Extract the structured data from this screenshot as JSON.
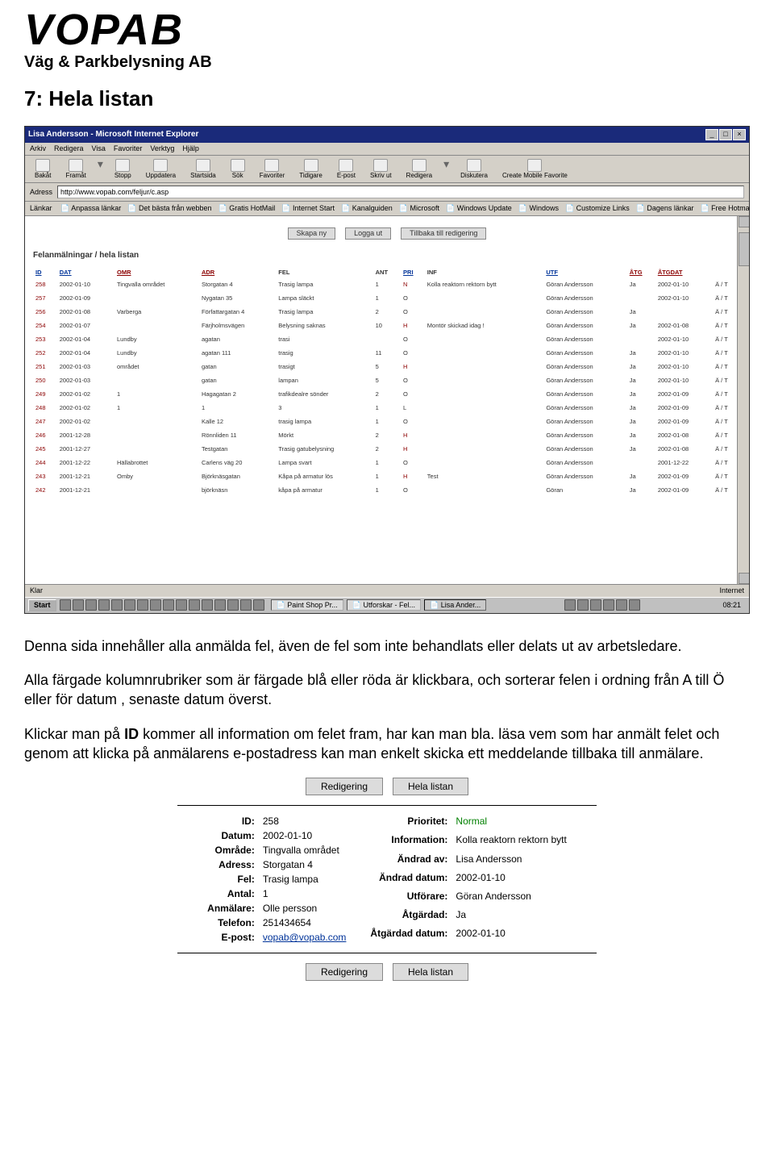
{
  "logo": {
    "word": "VOPAB",
    "sub": "Väg & Parkbelysning AB"
  },
  "section_title": "7: Hela listan",
  "browser": {
    "title": "Lisa Andersson - Microsoft Internet Explorer",
    "menu": [
      "Arkiv",
      "Redigera",
      "Visa",
      "Favoriter",
      "Verktyg",
      "Hjälp"
    ],
    "tools": [
      "Bakåt",
      "Framåt",
      "Stopp",
      "Uppdatera",
      "Startsida",
      "Sök",
      "Favoriter",
      "Tidigare",
      "E-post",
      "Skriv ut",
      "Redigera",
      "Diskutera",
      "Create Mobile Favorite"
    ],
    "address_label": "Adress",
    "address": "http://www.vopab.com/feljur/c.asp",
    "links_label": "Länkar",
    "links": [
      "Anpassa länkar",
      "Det bästa från webben",
      "Gratis HotMail",
      "Internet Start",
      "Kanalguiden",
      "Microsoft",
      "Windows Update",
      "Windows",
      "Customize Links",
      "Dagens länkar",
      "Free Hotmail"
    ],
    "page_buttons": [
      "Skapa ny",
      "Logga ut",
      "Tillbaka till redigering"
    ],
    "table_title": "Felanmälningar / hela listan",
    "headers": [
      {
        "t": "ID",
        "cls": "blue"
      },
      {
        "t": "DAT",
        "cls": "blue"
      },
      {
        "t": "OMR",
        "cls": "red"
      },
      {
        "t": "ADR",
        "cls": "red"
      },
      {
        "t": "FEL",
        "cls": ""
      },
      {
        "t": "ANT",
        "cls": ""
      },
      {
        "t": "PRI",
        "cls": "blue"
      },
      {
        "t": "INF",
        "cls": ""
      },
      {
        "t": "UTF",
        "cls": "blue"
      },
      {
        "t": "ÅTG",
        "cls": "red"
      },
      {
        "t": "ÅTGDAT",
        "cls": "red"
      },
      {
        "t": "",
        "cls": ""
      }
    ],
    "rows": [
      {
        "id": "258",
        "dat": "2002-01-10",
        "omr": "Tingvalla området",
        "adr": "Storgatan 4",
        "fel": "Trasig lampa",
        "ant": "1",
        "pri": "N",
        "inf": "Kolla reaktorn rektorn bytt",
        "utf": "Göran Andersson",
        "atg": "Ja",
        "atgdat": "2002-01-10",
        "act": "Ä / T"
      },
      {
        "id": "257",
        "dat": "2002-01-09",
        "omr": "",
        "adr": "Nygatan 35",
        "fel": "Lampa släckt",
        "ant": "1",
        "pri": "O",
        "inf": "",
        "utf": "Göran Andersson",
        "atg": "",
        "atgdat": "2002-01-10",
        "act": "Ä / T"
      },
      {
        "id": "256",
        "dat": "2002-01-08",
        "omr": "Varberga",
        "adr": "Författargatan 4",
        "fel": "Trasig lampa",
        "ant": "2",
        "pri": "O",
        "inf": "",
        "utf": "Göran Andersson",
        "atg": "Ja",
        "atgdat": "",
        "act": "Ä / T"
      },
      {
        "id": "254",
        "dat": "2002-01-07",
        "omr": "",
        "adr": "Färjholmsvägen",
        "fel": "Belysning saknas",
        "ant": "10",
        "pri": "H",
        "inf": "Montör skickad idag !",
        "utf": "Göran Andersson",
        "atg": "Ja",
        "atgdat": "2002-01-08",
        "act": "Ä / T"
      },
      {
        "id": "253",
        "dat": "2002-01-04",
        "omr": "Lundby",
        "adr": "agatan",
        "fel": "trasi",
        "ant": "",
        "pri": "O",
        "inf": "",
        "utf": "Göran Andersson",
        "atg": "",
        "atgdat": "2002-01-10",
        "act": "Ä / T"
      },
      {
        "id": "252",
        "dat": "2002-01-04",
        "omr": "Lundby",
        "adr": "agatan 111",
        "fel": "trasig",
        "ant": "11",
        "pri": "O",
        "inf": "",
        "utf": "Göran Andersson",
        "atg": "Ja",
        "atgdat": "2002-01-10",
        "act": "Ä / T"
      },
      {
        "id": "251",
        "dat": "2002-01-03",
        "omr": "området",
        "adr": "gatan",
        "fel": "trasigt",
        "ant": "5",
        "pri": "H",
        "inf": "",
        "utf": "Göran Andersson",
        "atg": "Ja",
        "atgdat": "2002-01-10",
        "act": "Ä / T"
      },
      {
        "id": "250",
        "dat": "2002-01-03",
        "omr": "",
        "adr": "gatan",
        "fel": "lampan",
        "ant": "5",
        "pri": "O",
        "inf": "",
        "utf": "Göran Andersson",
        "atg": "Ja",
        "atgdat": "2002-01-10",
        "act": "Ä / T"
      },
      {
        "id": "249",
        "dat": "2002-01-02",
        "omr": "1",
        "adr": "Hagagatan 2",
        "fel": "trafikdealre sönder",
        "ant": "2",
        "pri": "O",
        "inf": "",
        "utf": "Göran Andersson",
        "atg": "Ja",
        "atgdat": "2002-01-09",
        "act": "Ä / T"
      },
      {
        "id": "248",
        "dat": "2002-01-02",
        "omr": "1",
        "adr": "1",
        "fel": "3",
        "ant": "1",
        "pri": "L",
        "inf": "",
        "utf": "Göran Andersson",
        "atg": "Ja",
        "atgdat": "2002-01-09",
        "act": "Ä / T"
      },
      {
        "id": "247",
        "dat": "2002-01-02",
        "omr": "",
        "adr": "Kalle 12",
        "fel": "trasig lampa",
        "ant": "1",
        "pri": "O",
        "inf": "",
        "utf": "Göran Andersson",
        "atg": "Ja",
        "atgdat": "2002-01-09",
        "act": "Ä / T"
      },
      {
        "id": "246",
        "dat": "2001-12-28",
        "omr": "",
        "adr": "Rönnliden 11",
        "fel": "Mörkt",
        "ant": "2",
        "pri": "H",
        "inf": "",
        "utf": "Göran Andersson",
        "atg": "Ja",
        "atgdat": "2002-01-08",
        "act": "Ä / T"
      },
      {
        "id": "245",
        "dat": "2001-12-27",
        "omr": "",
        "adr": "Testgatan",
        "fel": "Trasig gatubelysning",
        "ant": "2",
        "pri": "H",
        "inf": "",
        "utf": "Göran Andersson",
        "atg": "Ja",
        "atgdat": "2002-01-08",
        "act": "Ä / T"
      },
      {
        "id": "244",
        "dat": "2001-12-22",
        "omr": "Hällabrottet",
        "adr": "Carlens väg 20",
        "fel": "Lampa svart",
        "ant": "1",
        "pri": "O",
        "inf": "",
        "utf": "Göran Andersson",
        "atg": "",
        "atgdat": "2001-12-22",
        "act": "Ä / T"
      },
      {
        "id": "243",
        "dat": "2001-12-21",
        "omr": "Omby",
        "adr": "Björknäsgatan",
        "fel": "Kåpa på armatur lös",
        "ant": "1",
        "pri": "H",
        "inf": "Test",
        "utf": "Göran Andersson",
        "atg": "Ja",
        "atgdat": "2002-01-09",
        "act": "Ä / T"
      },
      {
        "id": "242",
        "dat": "2001-12-21",
        "omr": "",
        "adr": "björknäsn",
        "fel": "kåpa på armatur",
        "ant": "1",
        "pri": "O",
        "inf": "",
        "utf": "Göran",
        "atg": "Ja",
        "atgdat": "2002-01-09",
        "act": "Ä / T"
      }
    ],
    "status_left": "Klar",
    "status_right": "Internet",
    "taskbar": {
      "start": "Start",
      "tasks": [
        "Paint Shop Pr...",
        "Utforskar - Fel...",
        "Lisa Ander..."
      ],
      "clock": "08:21"
    }
  },
  "para1": "Denna sida innehåller alla anmälda fel, även de fel som inte behandlats eller delats ut av arbetsledare.",
  "para2": "Alla färgade kolumnrubriker som är färgade blå eller röda är klickbara, och sorterar felen i ordning från A till Ö eller för datum , senaste datum överst.",
  "para3a": "Klickar man på ",
  "para3b": "ID",
  "para3c": " kommer all information om felet fram, har kan man bla. läsa vem som har anmält felet och genom att klicka på anmälarens e-postadress kan man enkelt skicka ett meddelande tillbaka till anmälare.",
  "detail": {
    "buttons": [
      "Redigering",
      "Hela listan"
    ],
    "left": [
      {
        "l": "ID:",
        "v": "258"
      },
      {
        "l": "Datum:",
        "v": "2002-01-10"
      },
      {
        "l": "Område:",
        "v": "Tingvalla området"
      },
      {
        "l": "Adress:",
        "v": "Storgatan 4"
      },
      {
        "l": "Fel:",
        "v": "Trasig lampa"
      },
      {
        "l": "Antal:",
        "v": "1"
      },
      {
        "l": "Anmälare:",
        "v": "Olle persson"
      },
      {
        "l": "Telefon:",
        "v": "251434654"
      },
      {
        "l": "E-post:",
        "v": "vopab@vopab.com",
        "link": true
      }
    ],
    "right": [
      {
        "l": "Prioritet:",
        "v": "Normal",
        "green": true
      },
      {
        "l": "Information:",
        "v": "Kolla reaktorn rektorn bytt"
      },
      {
        "l": "Ändrad av:",
        "v": "Lisa Andersson"
      },
      {
        "l": "Ändrad datum:",
        "v": "2002-01-10"
      },
      {
        "l": "Utförare:",
        "v": "Göran Andersson"
      },
      {
        "l": "Åtgärdad:",
        "v": "Ja"
      },
      {
        "l": "Åtgärdad datum:",
        "v": "2002-01-10"
      }
    ]
  }
}
